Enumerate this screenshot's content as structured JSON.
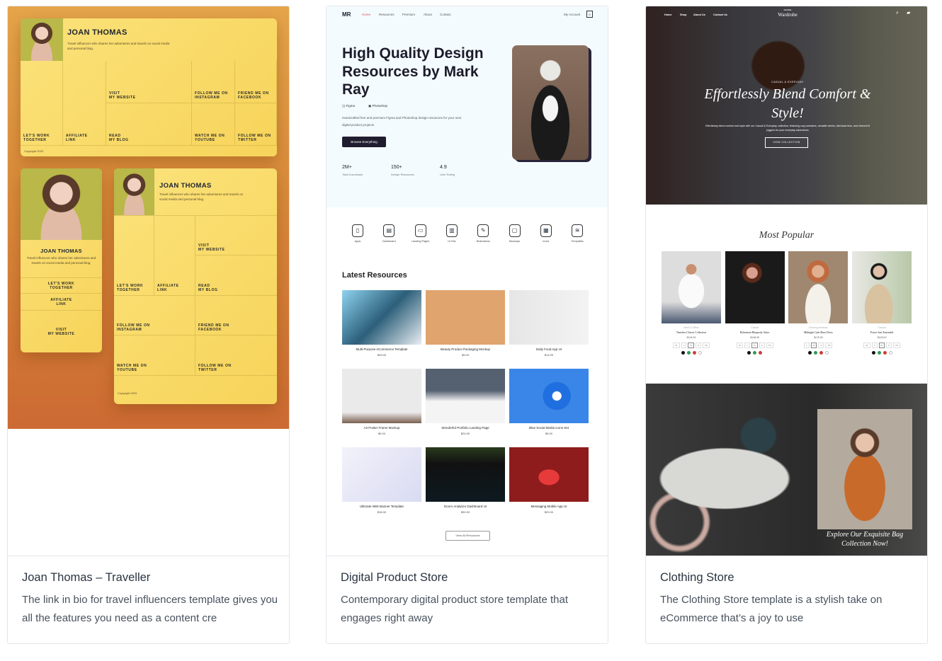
{
  "cards": [
    {
      "title": "Joan Thomas – Traveller",
      "description": "The link in bio for travel influencers template gives you all the features you need as a content cre",
      "preview": {
        "name": "JOAN THOMAS",
        "bio": "Travel influencer who shares her adventures and travels on social media and personal blog.",
        "links": {
          "work": "LET'S WORK\nTOGETHER",
          "affiliate": "AFFILIATE\nLINK",
          "website": "VISIT\nMY WEBSITE",
          "blog": "READ\nMY BLOG",
          "instagram": "FOLLOW ME ON\nINSTAGRAM",
          "facebook": "FRIEND ME ON\nFACEBOOK",
          "youtube": "WATCH ME ON\nYOUTUBE",
          "twitter": "FOLLOW ME ON\nTWITTER"
        },
        "copyright": "Copyright 2023"
      }
    },
    {
      "title": "Digital Product Store",
      "description": "Contemporary digital product store template that engages right away",
      "preview": {
        "logo": "MR",
        "nav": [
          "Home",
          "Resources",
          "Premium",
          "About",
          "Contact"
        ],
        "account": "My Account",
        "cart_count": "0",
        "hero_title": "High Quality Design Resources by Mark Ray",
        "tools": [
          "Figma",
          "Photoshop"
        ],
        "hero_text": "Handcrafted free and premium Figma and Photoshop design resources for your next digital product projects",
        "cta": "Browse Everything",
        "stats": [
          {
            "value": "2M+",
            "label": "Total Downloads"
          },
          {
            "value": "150+",
            "label": "Design Resources"
          },
          {
            "value": "4.9",
            "label": "User Rating"
          }
        ],
        "categories": [
          "Apps",
          "Dashboard",
          "Landing Pages",
          "UI Kits",
          "Illustrations",
          "Mockups",
          "Icons",
          "Templates"
        ],
        "latest_heading": "Latest Resources",
        "resources": [
          {
            "title": "Multi-Purpose eCommerce Template",
            "price": "$39.00"
          },
          {
            "title": "Beauty Product Packaging Mockup",
            "price": "$9.00"
          },
          {
            "title": "Daily Food App UI",
            "price": "$14.00"
          },
          {
            "title": "A3 Poster Frame Mockup",
            "price": "$0.00"
          },
          {
            "title": "Wonderful Portfolio Landing Page",
            "price": "$24.00"
          },
          {
            "title": "Blue Social Media Icons Set",
            "price": "$9.00"
          },
          {
            "title": "Ultimate Web Banner Template",
            "price": "$18.00"
          },
          {
            "title": "Doorn Analytics Dashboard UI",
            "price": "$30.00"
          },
          {
            "title": "Messaging Mobile App UI",
            "price": "$20.00"
          }
        ],
        "view_all": "View All Resources"
      }
    },
    {
      "title": "Clothing Store",
      "description": "The Clothing Store template is a stylish take on eCommerce that’s a joy to use",
      "preview": {
        "nav": [
          "Home",
          "Shop",
          "About Us",
          "Contact Us"
        ],
        "brand_small": "FEMME",
        "brand": "Wardrobe",
        "eyebrow": "CASUAL & EVERYDAY",
        "hero_title": "Effortlessly Blend Comfort & Style!",
        "hero_text": "Effortlessly blend comfort and style with our Casual & Everyday collection, featuring cozy sweaters, versatile denim, laid-back tees, and relaxed-fit joggers for your everyday adventures",
        "cta": "VIEW COLLECTION",
        "popular_heading": "Most Popular",
        "products": [
          {
            "category": "Work & Office",
            "name": "Timeless Classic Collection",
            "price": "$124.99",
            "sizes": [
              "XL",
              "L",
              "M",
              "S",
              "XS"
            ],
            "colors": [
              "#111111",
              "#2e9a5a",
              "#d23a3a",
              "#ffffff"
            ]
          },
          {
            "category": "Casual",
            "name": "Bohemian Rhapsody Attire",
            "price": "$148.99",
            "sizes": [
              "XL",
              "L",
              "M",
              "S",
              "XS"
            ],
            "colors": [
              "#111111",
              "#2e9a5a",
              "#d23a3a"
            ]
          },
          {
            "category": "Evening Dresses",
            "name": "Midnight Gala Maxi Dress",
            "price": "$175.00",
            "sizes": [
              "L",
              "M",
              "S",
              "XS"
            ],
            "colors": [
              "#111111",
              "#2e9a5a",
              "#d23a3a",
              "#ffffff"
            ]
          },
          {
            "category": "Casual",
            "name": "Power Suit Ensemble",
            "price": "$125.00",
            "sizes": [
              "XL",
              "L",
              "M",
              "S",
              "XS"
            ],
            "colors": [
              "#111111",
              "#2e9a5a",
              "#d23a3a",
              "#ffffff"
            ]
          }
        ],
        "banner_text": "Explore Our Exquisite Bag Collection Now!"
      }
    }
  ]
}
